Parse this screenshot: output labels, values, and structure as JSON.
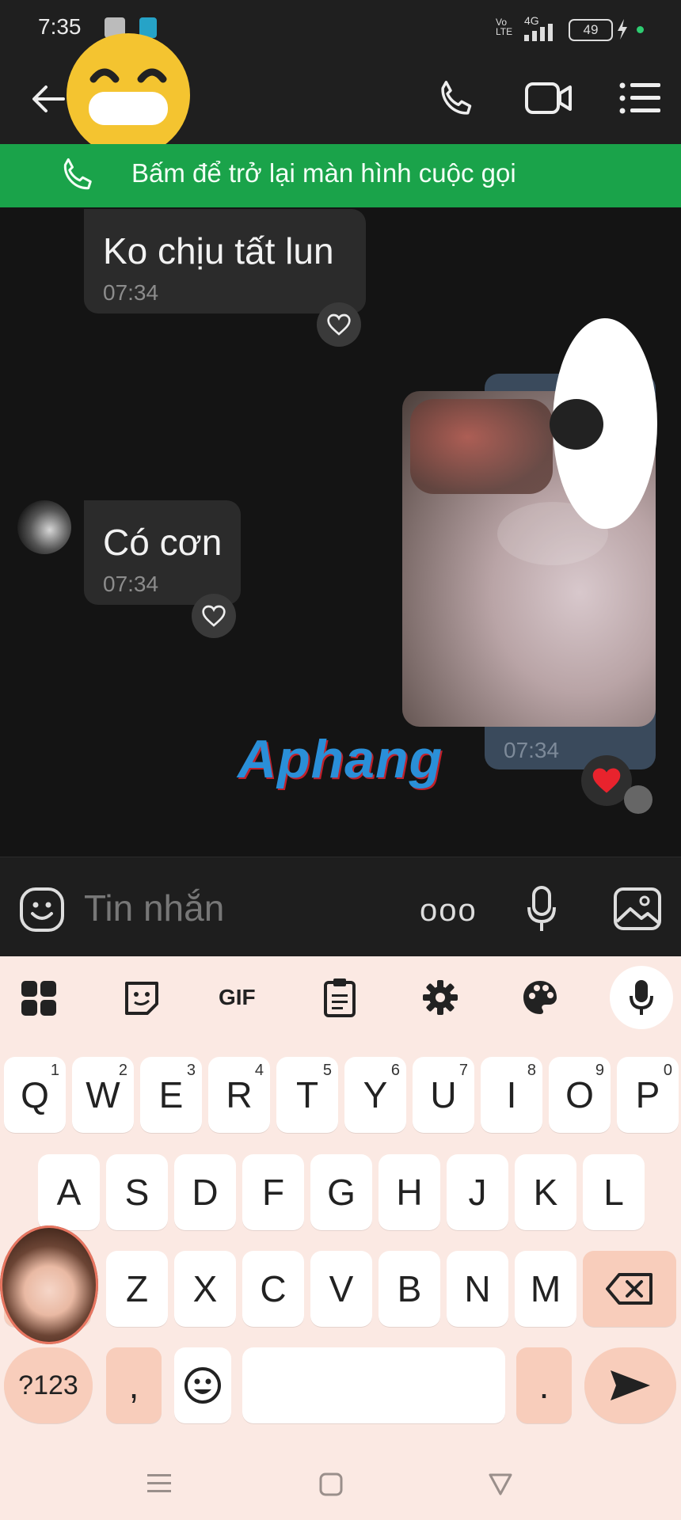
{
  "status_bar": {
    "time": "7:35",
    "signal_label": "4G",
    "volte_label": "Vo\nLTE",
    "battery": "49"
  },
  "header": {
    "back_icon": "back-arrow-icon",
    "actions": [
      "phone-icon",
      "video-call-icon",
      "menu-list-icon"
    ]
  },
  "call_banner": {
    "text": "Bấm để trở lại màn hình cuộc gọi"
  },
  "messages": [
    {
      "side": "incoming",
      "text": "Ko chịu tất lun",
      "time": "07:34",
      "reaction": "heart-outline"
    },
    {
      "side": "outgoing",
      "type": "image",
      "time": "07:34",
      "reaction": "heart-red"
    },
    {
      "side": "incoming",
      "text": "Có cơn",
      "time": "07:34",
      "reaction": "heart-outline"
    }
  ],
  "watermark": "Aphang",
  "composer": {
    "placeholder": "Tin nhắn",
    "more_label": "ooo"
  },
  "keyboard": {
    "toolbar": [
      "apps-grid-icon",
      "sticker-icon",
      "GIF",
      "clipboard-icon",
      "settings-icon",
      "palette-icon",
      "mic-icon"
    ],
    "row1": [
      {
        "k": "Q",
        "h": "1"
      },
      {
        "k": "W",
        "h": "2"
      },
      {
        "k": "E",
        "h": "3"
      },
      {
        "k": "R",
        "h": "4"
      },
      {
        "k": "T",
        "h": "5"
      },
      {
        "k": "Y",
        "h": "6"
      },
      {
        "k": "U",
        "h": "7"
      },
      {
        "k": "I",
        "h": "8"
      },
      {
        "k": "O",
        "h": "9"
      },
      {
        "k": "P",
        "h": "0"
      }
    ],
    "row2": [
      "A",
      "S",
      "D",
      "F",
      "G",
      "H",
      "J",
      "K",
      "L"
    ],
    "row3": [
      "Z",
      "X",
      "C",
      "V",
      "B",
      "N",
      "M"
    ],
    "symbols_label": "?123",
    "comma_label": ",",
    "period_label": "."
  },
  "colors": {
    "banner": "#1aa34a",
    "keyboard_bg": "#fbe9e3",
    "key_accent": "#f8cdbb",
    "heart": "#e8232d"
  }
}
